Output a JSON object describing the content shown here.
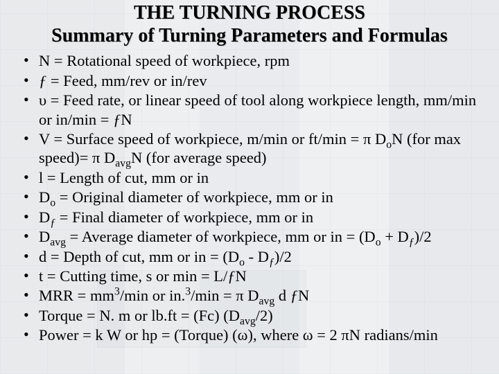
{
  "heading": {
    "title": "THE TURNING PROCESS",
    "subtitle": "Summary of Turning Parameters and Formulas"
  },
  "items": [
    {
      "html": "N = Rotational speed of workpiece, rpm"
    },
    {
      "html": "<span class=\"ital\">ƒ</span> = Feed, mm/rev or in/rev"
    },
    {
      "html": "υ = Feed rate, or linear speed of tool along workpiece length, mm/min or in/min  = <span class=\"ital\">ƒ</span>N"
    },
    {
      "html": "V = Surface speed of workpiece, m/min or ft/min = π D<sub>o</sub>N (for max speed)= π D<sub>avg</sub>N (for average speed)"
    },
    {
      "html": "l = Length of cut, mm or in"
    },
    {
      "html": "D<sub>o</sub> = Original diameter of workpiece, mm or in"
    },
    {
      "html": "D<sub><span class=\"ital\">ƒ</span></sub> = Final diameter of workpiece, mm or in"
    },
    {
      "html": "D<sub>avg</sub> = Average diameter of workpiece, mm or in = (D<sub>o</sub> + D<sub><span class=\"ital\">ƒ</span></sub>)/2"
    },
    {
      "html": "d = Depth of cut, mm or in  = (D<sub>o</sub>  - D<sub><span class=\"ital\">ƒ</span></sub>)/2"
    },
    {
      "html": "t = Cutting time, s or min = L/<span class=\"ital\">ƒ</span>N"
    },
    {
      "html": "MRR = mm<sup>3</sup>/min or in.<sup>3</sup>/min = π D<sub>avg</sub> d <span class=\"ital\">ƒ</span>N"
    },
    {
      "html": "Torque = N. m or lb.ft = (Fc) (D<sub>avg</sub>/2)"
    },
    {
      "html": "Power = k W or hp = (Torque) (ω), where ω = 2 πN radians/min"
    }
  ]
}
